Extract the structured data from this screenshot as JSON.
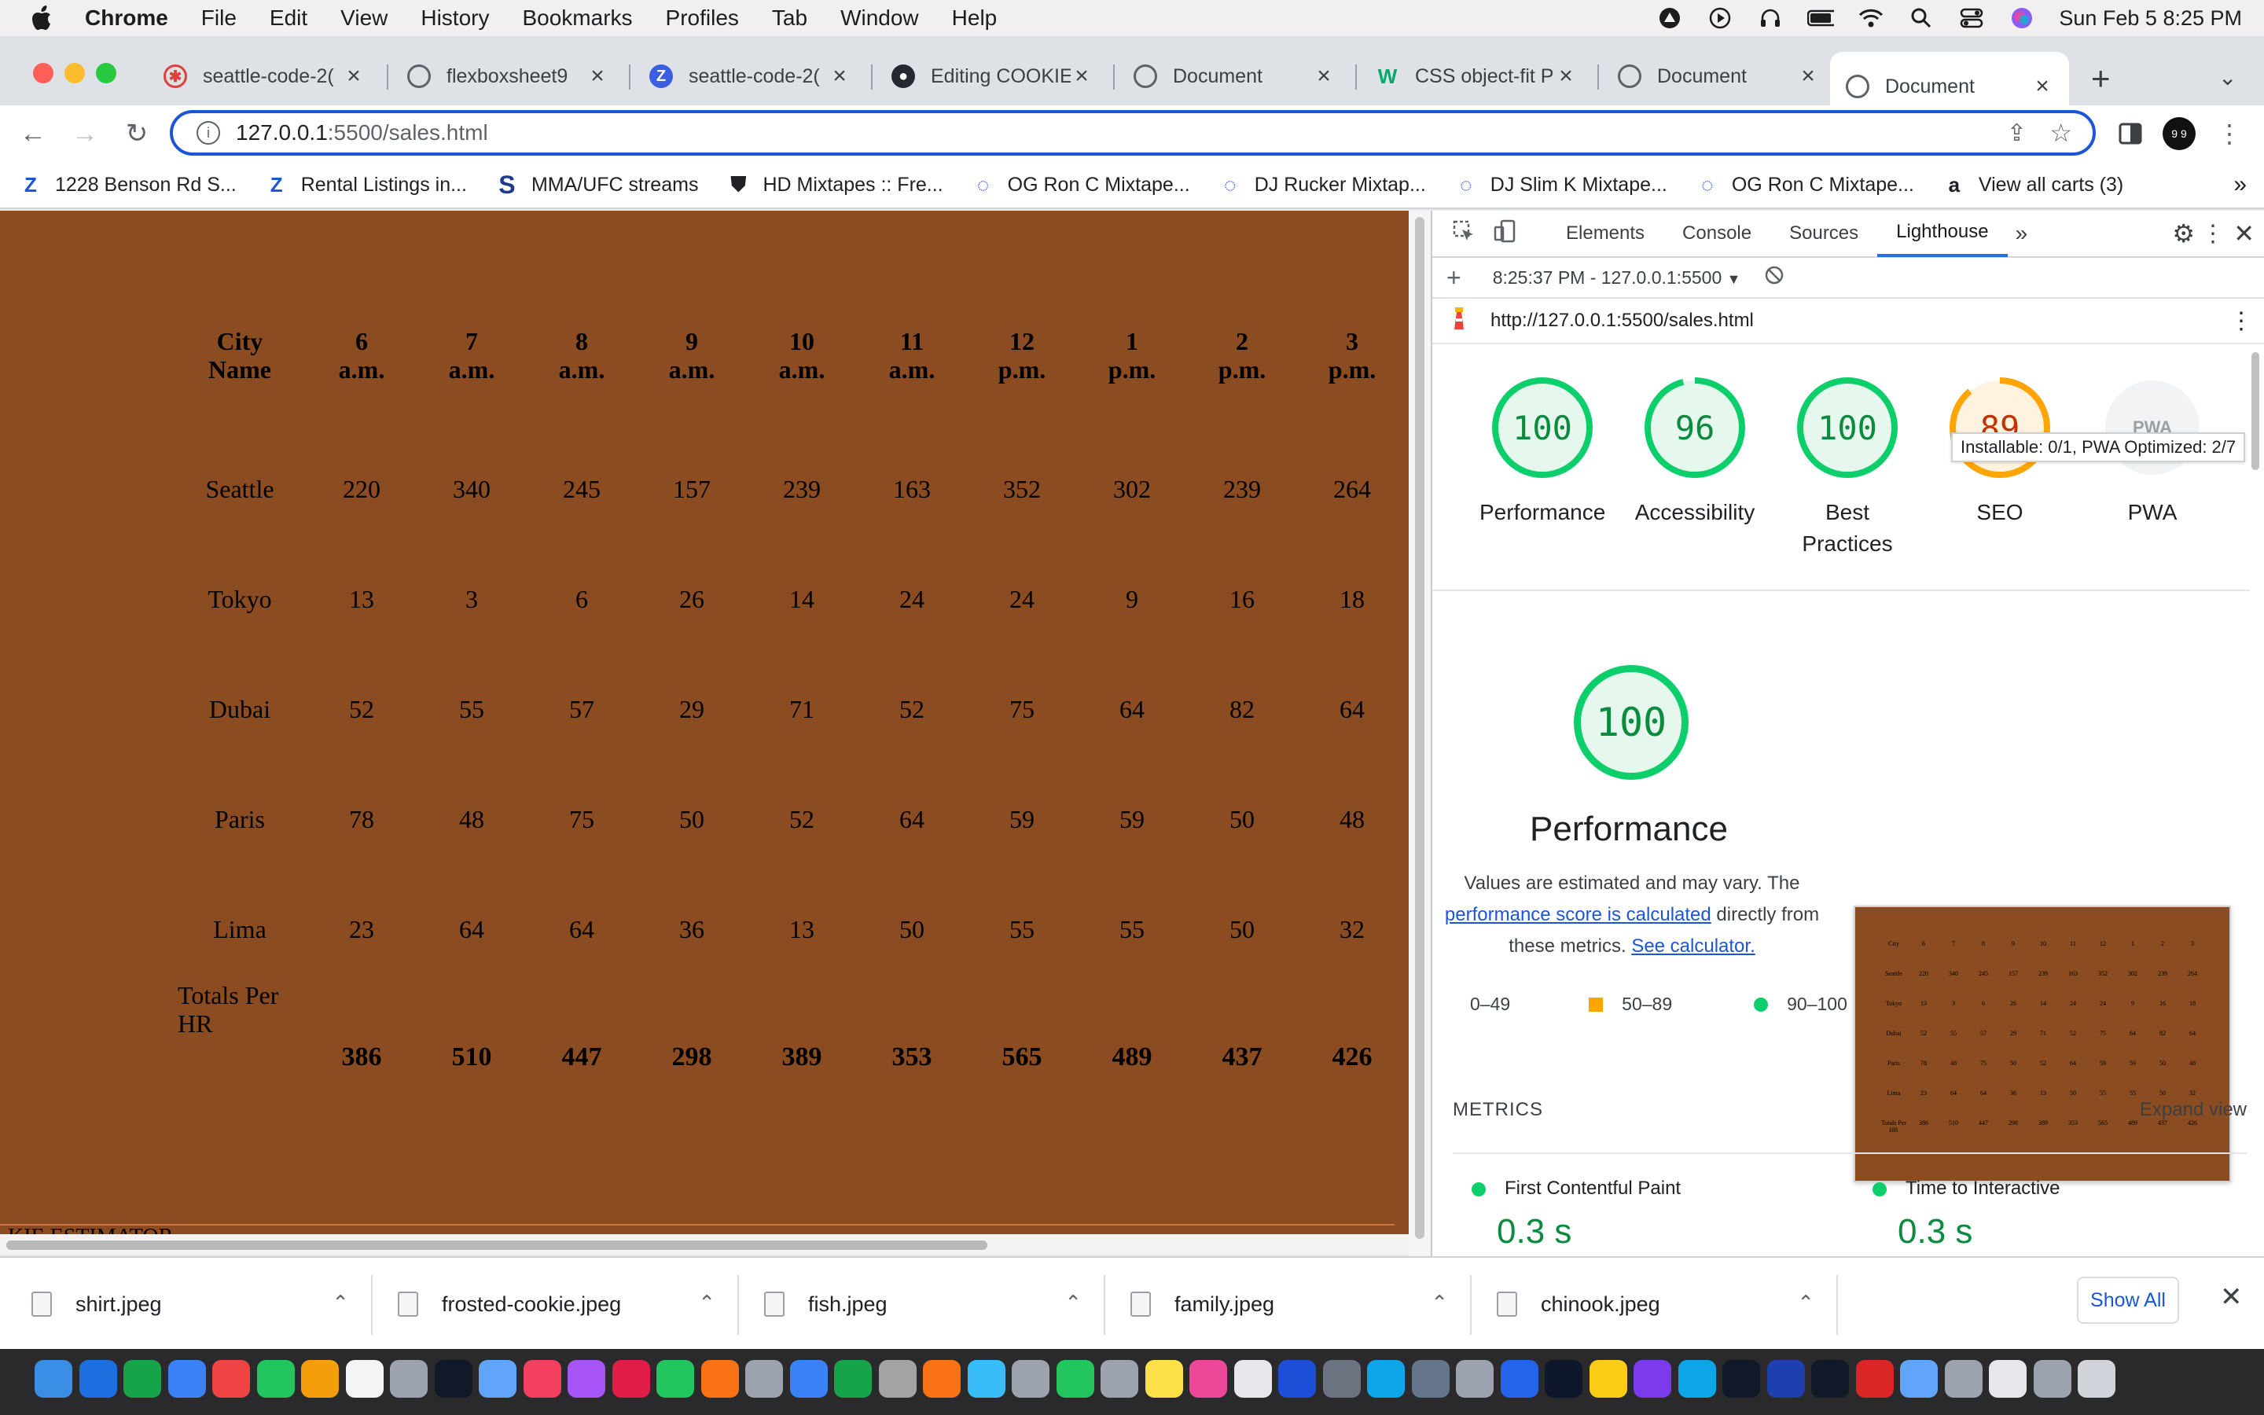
{
  "menubar": {
    "app": "Chrome",
    "items": [
      "File",
      "Edit",
      "View",
      "History",
      "Bookmarks",
      "Profiles",
      "Tab",
      "Window",
      "Help"
    ],
    "datetime": "Sun Feb 5  8:25 PM"
  },
  "tabs": [
    {
      "title": "seattle-code-2(",
      "active": false
    },
    {
      "title": "flexboxsheet9",
      "active": false
    },
    {
      "title": "seattle-code-2(",
      "active": false
    },
    {
      "title": "Editing COOKIE",
      "active": false
    },
    {
      "title": "Document",
      "active": false
    },
    {
      "title": "CSS object-fit P",
      "active": false
    },
    {
      "title": "Document",
      "active": false
    },
    {
      "title": "Document",
      "active": true
    }
  ],
  "omnibox": {
    "host": "127.0.0.1",
    "path": ":5500/sales.html"
  },
  "bookmarks": [
    "1228 Benson Rd S...",
    "Rental Listings in...",
    "MMA/UFC streams",
    "HD Mixtapes :: Fre...",
    "OG Ron C Mixtape...",
    "DJ Rucker Mixtap...",
    "DJ Slim K Mixtape...",
    "OG Ron C Mixtape...",
    "View all carts (3)"
  ],
  "sales_table": {
    "headers": [
      {
        "top": "City",
        "bottom": "Name"
      },
      {
        "top": "6",
        "bottom": "a.m."
      },
      {
        "top": "7",
        "bottom": "a.m."
      },
      {
        "top": "8",
        "bottom": "a.m."
      },
      {
        "top": "9",
        "bottom": "a.m."
      },
      {
        "top": "10",
        "bottom": "a.m."
      },
      {
        "top": "11",
        "bottom": "a.m."
      },
      {
        "top": "12",
        "bottom": "p.m."
      },
      {
        "top": "1",
        "bottom": "p.m."
      },
      {
        "top": "2",
        "bottom": "p.m."
      },
      {
        "top": "3",
        "bottom": "p.m."
      }
    ],
    "rows": [
      {
        "city": "Seattle",
        "values": [
          "220",
          "340",
          "245",
          "157",
          "239",
          "163",
          "352",
          "302",
          "239",
          "264"
        ]
      },
      {
        "city": "Tokyo",
        "values": [
          "13",
          "3",
          "6",
          "26",
          "14",
          "24",
          "24",
          "9",
          "16",
          "18"
        ]
      },
      {
        "city": "Dubai",
        "values": [
          "52",
          "55",
          "57",
          "29",
          "71",
          "52",
          "75",
          "64",
          "82",
          "64"
        ]
      },
      {
        "city": "Paris",
        "values": [
          "78",
          "48",
          "75",
          "50",
          "52",
          "64",
          "59",
          "59",
          "50",
          "48"
        ]
      },
      {
        "city": "Lima",
        "values": [
          "23",
          "64",
          "64",
          "36",
          "13",
          "50",
          "55",
          "55",
          "50",
          "32"
        ]
      }
    ],
    "totals_label": "Totals Per HR",
    "totals": [
      "386",
      "510",
      "447",
      "298",
      "389",
      "353",
      "565",
      "489",
      "437",
      "426"
    ],
    "estimator_text": "KIE ESTIMATOR"
  },
  "devtools": {
    "tabs": [
      "Elements",
      "Console",
      "Sources",
      "Lighthouse"
    ],
    "active_tab": "Lighthouse",
    "report_time": "8:25:37 PM - 127.0.0.1:5500",
    "url": "http://127.0.0.1:5500/sales.html",
    "scores": [
      {
        "label": "Performance",
        "value": "100",
        "fraction": 1.0,
        "color": "#0cce6b"
      },
      {
        "label": "Accessibility",
        "value": "96",
        "fraction": 0.96,
        "color": "#0cce6b"
      },
      {
        "label": "Best Practices",
        "value": "100",
        "fraction": 1.0,
        "color": "#0cce6b"
      },
      {
        "label": "SEO",
        "value": "89",
        "fraction": 0.89,
        "color": "#ffa400"
      },
      {
        "label": "PWA",
        "value": "PWA",
        "fraction": 0,
        "color": "#9aa0a6"
      }
    ],
    "tooltip": "Installable: 0/1, PWA Optimized: 2/7",
    "performance": {
      "score": "100",
      "title": "Performance",
      "desc_prefix": "Values are estimated and may vary. The",
      "link1": "performance score is calculated",
      "desc_mid": "directly from these metrics.",
      "link2": "See calculator."
    },
    "legend": [
      {
        "label": "0–49",
        "shape": "triangle",
        "color": "#ff4e42"
      },
      {
        "label": "50–89",
        "shape": "square",
        "color": "#ffa400"
      },
      {
        "label": "90–100",
        "shape": "circle",
        "color": "#0cce6b"
      }
    ],
    "metrics_heading": "METRICS",
    "expand_view": "Expand view",
    "metrics": [
      {
        "name": "First Contentful Paint",
        "value": "0.3 s"
      },
      {
        "name": "Time to Interactive",
        "value": "0.3 s"
      }
    ]
  },
  "downloads": {
    "items": [
      "shirt.jpeg",
      "frosted-cookie.jpeg",
      "fish.jpeg",
      "family.jpeg",
      "chinook.jpeg"
    ],
    "show_all": "Show All"
  },
  "accent_colors": {
    "page_bg": "#8a4c20",
    "focus_ring": "#1a56d6",
    "good": "#0cce6b",
    "average": "#ffa400"
  }
}
